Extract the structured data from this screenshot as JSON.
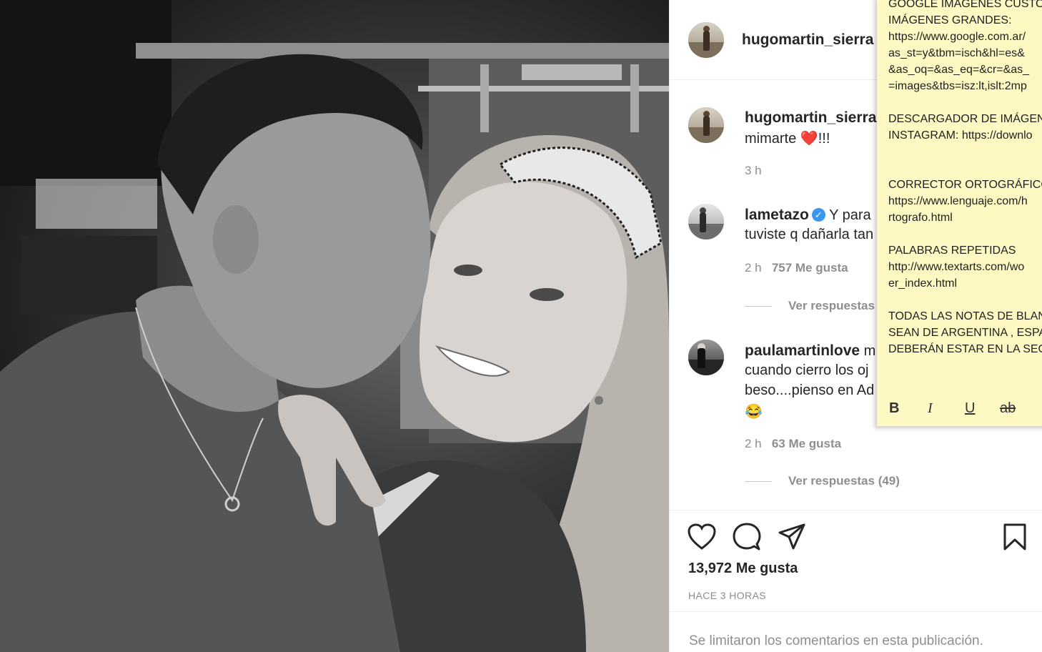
{
  "post": {
    "author": "hugomartin_sierra",
    "likes": "13,972 Me gusta",
    "timestamp": "HACE 3 HORAS",
    "comments_limited": "Se limitaron los comentarios en esta publicación."
  },
  "caption": {
    "username": "hugomartin_sierra",
    "text_before": "mimarte ",
    "heart": "❤️",
    "text_after": "!!!",
    "time": "3 h"
  },
  "comments": [
    {
      "username": "lametazo",
      "verified": true,
      "line1": "Y para",
      "line2": "tuviste q dañarla tan",
      "time": "2 h",
      "likes": "757 Me gusta",
      "replies": "Ver respuestas"
    },
    {
      "username": "paulamartinlove",
      "line1": "m",
      "line2": "cuando cierro los oj",
      "line3": "beso....pienso en Ad",
      "emoji": "😂",
      "time": "2 h",
      "likes": "63 Me gusta",
      "replies": "Ver respuestas (49)"
    }
  ],
  "icons": {
    "like": "heart-outline-icon",
    "comment": "speech-bubble-icon",
    "share": "paper-plane-icon",
    "save": "bookmark-icon",
    "verified": "verified-check-icon"
  },
  "sticky_note": {
    "lines": [
      "GOOGLE IMÁGENES CUSTO",
      "IMÁGENES GRANDES:",
      "https://www.google.com.ar/",
      "as_st=y&tbm=isch&hl=es&",
      "&as_oq=&as_eq=&cr=&as_",
      "=images&tbs=isz:lt,islt:2mp",
      "",
      "DESCARGADOR DE IMÁGEN",
      "INSTAGRAM: https://downlo",
      "",
      "",
      "CORRECTOR ORTOGRÁFICO",
      "https://www.lenguaje.com/h",
      "rtografo.html",
      "",
      "PALABRAS REPETIDAS",
      "http://www.textarts.com/wo",
      "er_index.html",
      "",
      "TODAS LAS NOTAS DE BLAN",
      "SEAN DE ARGENTINA , ESPA",
      "DEBERÁN ESTAR EN LA SECC"
    ],
    "toolbar": {
      "bold": "B",
      "italic": "I",
      "underline": "U",
      "strike": "ab"
    }
  },
  "colors": {
    "verified_blue": "#3897f0",
    "sticky_yellow": "#fef9c3",
    "text_primary": "#262626",
    "text_secondary": "#8e8e8e"
  }
}
